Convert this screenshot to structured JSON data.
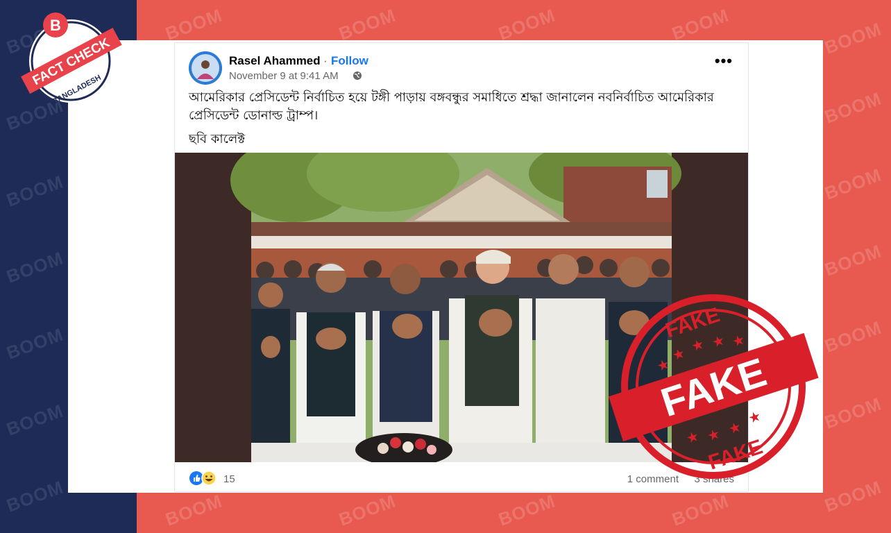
{
  "watermark": {
    "text": "BOOM"
  },
  "badge": {
    "top_text": "FACT CHECK",
    "bottom_text": "BANGLADESH",
    "logo": "B"
  },
  "post": {
    "author": "Rasel Ahammed",
    "separator": "·",
    "follow_label": "Follow",
    "date": "November 9 at 9:41 AM",
    "privacy_icon": "globe-icon",
    "more_label": "•••",
    "text_line1": "আমেরিকার প্রেসিডেন্ট নির্বাচিত হয়ে টঙ্গী পাড়ায় বঙ্গবন্ধুর সমাধিতে শ্রদ্ধা জানালেন নবনির্বাচিত আমেরিকার প্রেসিডেন্ট ডোনাল্ড ট্রাম্প।",
    "text_line2": "ছবি কালেক্ট",
    "reaction_count": "15",
    "comments": "1 comment",
    "shares": "3 shares"
  },
  "stamp": {
    "main": "FAKE",
    "top": "FAKE",
    "bottom": "FAKE"
  },
  "colors": {
    "navy": "#1f2b57",
    "red": "#e85a50",
    "stamp": "#d9202a",
    "link": "#1877f2"
  }
}
